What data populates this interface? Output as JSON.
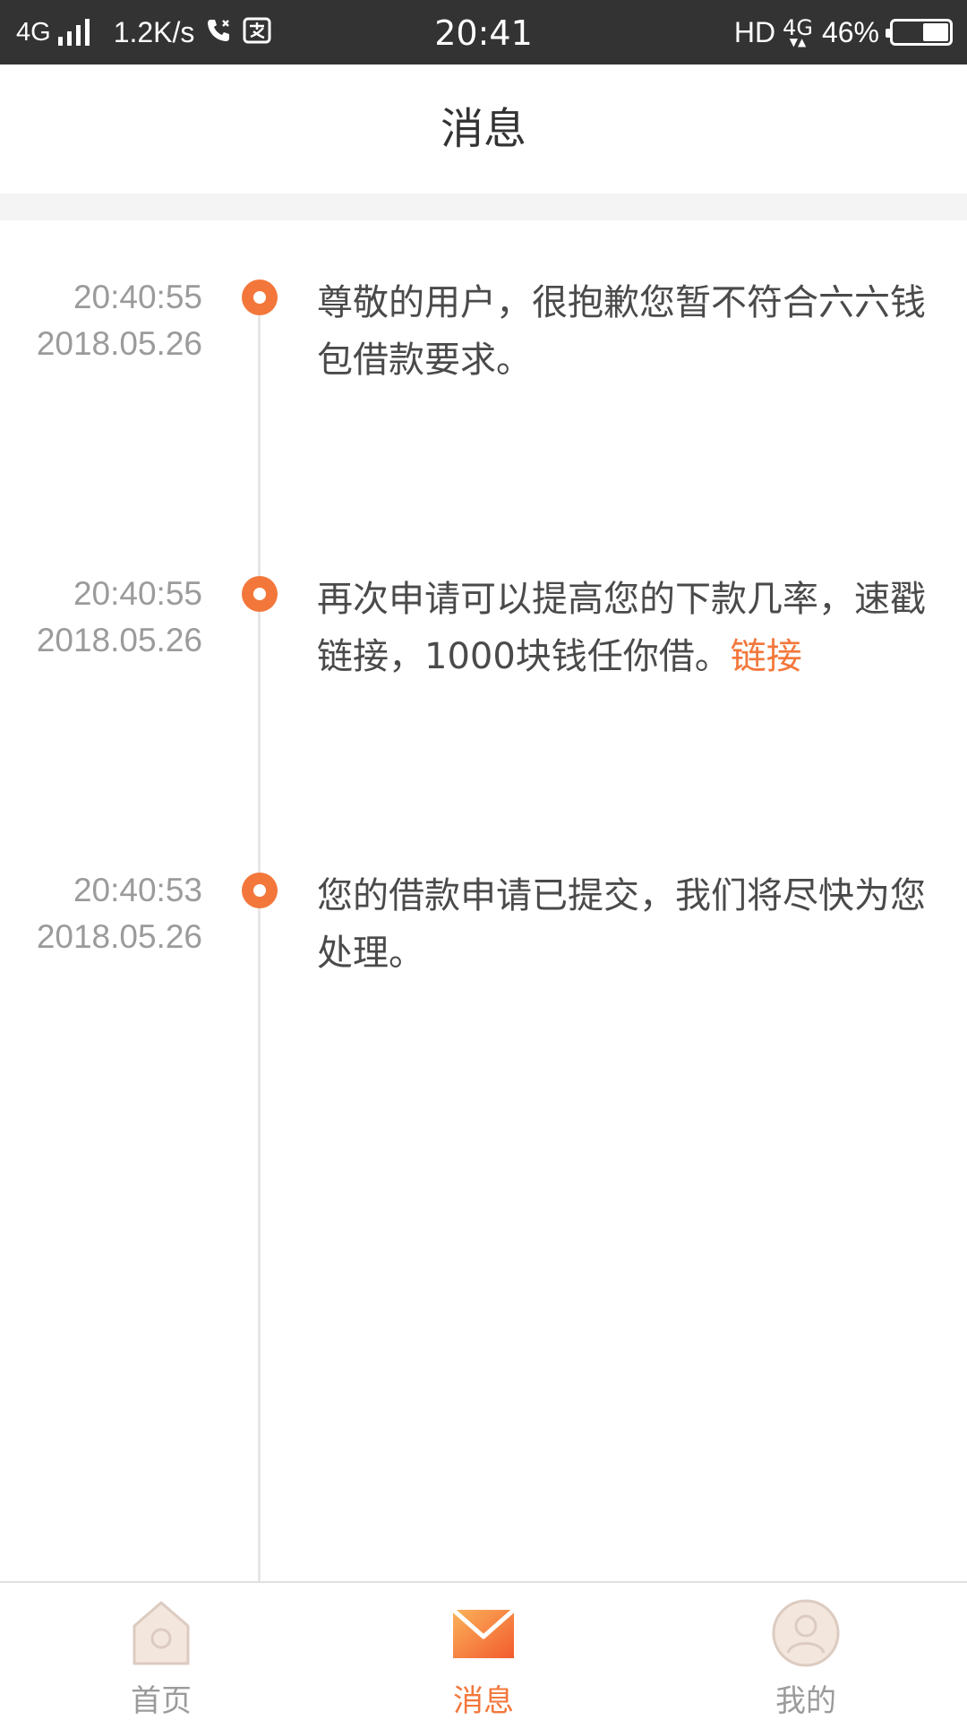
{
  "status_bar": {
    "network": "4G",
    "speed": "1.2K/s",
    "time": "20:41",
    "hd": "HD",
    "network_right": "4G",
    "battery": "46%",
    "battery_level": 0.46
  },
  "header": {
    "title": "消息"
  },
  "messages": [
    {
      "time": "20:40:55",
      "date": "2018.05.26",
      "text": "尊敬的用户，很抱歉您暂不符合六六钱包借款要求。",
      "link": ""
    },
    {
      "time": "20:40:55",
      "date": "2018.05.26",
      "text": "再次申请可以提高您的下款几率，速戳 链接，1000块钱任你借。",
      "link": "链接"
    },
    {
      "time": "20:40:53",
      "date": "2018.05.26",
      "text": "您的借款申请已提交，我们将尽快为您处理。",
      "link": ""
    }
  ],
  "tabs": [
    {
      "label": "首页",
      "icon": "home-icon",
      "active": false
    },
    {
      "label": "消息",
      "icon": "envelope-icon",
      "active": true
    },
    {
      "label": "我的",
      "icon": "profile-icon",
      "active": false
    }
  ],
  "colors": {
    "accent": "#f3773b",
    "status_bar": "#333333",
    "text": "#4a4a4a",
    "muted": "#9b9b9b"
  }
}
